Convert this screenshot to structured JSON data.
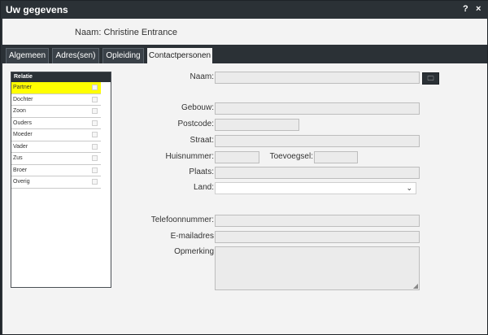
{
  "window": {
    "title": "Uw gegevens",
    "help": "?",
    "close": "×"
  },
  "header": {
    "name_line": "Naam: Christine Entrance"
  },
  "tabs": [
    "Algemeen",
    "Adres(sen)",
    "Opleiding",
    "Contactpersonen"
  ],
  "relatie": {
    "header": "Relatie",
    "items": [
      "Partner",
      "Dochter",
      "Zoon",
      "Ouders",
      "Moeder",
      "Vader",
      "Zus",
      "Broer",
      "Overig"
    ]
  },
  "form": {
    "naam": "Naam:",
    "gebouw": "Gebouw:",
    "postcode": "Postcode:",
    "straat": "Straat:",
    "huisnummer": "Huisnummer:",
    "toevoegsel": "Toevoegsel:",
    "plaats": "Plaats:",
    "land": "Land:",
    "telefoon": "Telefoonnummer:",
    "email": "E-mailadres",
    "opmerking": "Opmerking"
  },
  "icons": {
    "pick": "folder-icon",
    "dropdown": "chevron-down-icon",
    "resize": "resize-grip-icon"
  }
}
